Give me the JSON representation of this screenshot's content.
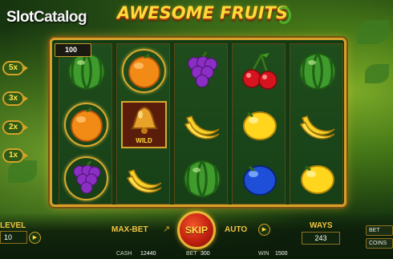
{
  "branding": {
    "site_logo_main": "Slot",
    "site_logo_accent": "Catalog"
  },
  "game": {
    "title": "AWESOME FRUITS"
  },
  "multipliers": [
    "5x",
    "3x",
    "2x",
    "1x"
  ],
  "reels": [
    [
      "watermelon",
      "orange",
      "grapes"
    ],
    [
      "orange",
      "bell-wild",
      "banana"
    ],
    [
      "grapes",
      "banana",
      "watermelon"
    ],
    [
      "cherry",
      "lemon",
      "plum"
    ],
    [
      "watermelon",
      "banana",
      "lemon"
    ]
  ],
  "highlighted_wins": [
    "reel-1-row-2",
    "reel-1-row-3",
    "reel-2-row-1",
    "reel-2-row-2"
  ],
  "symbols": {
    "wild_label": "WILD"
  },
  "win_badge": "100",
  "controls": {
    "level_label": "LEVEL",
    "level_value": "10",
    "max_bet_label": "MAX-BET",
    "spin_label": "SKIP",
    "auto_label": "AUTO",
    "ways_label": "WAYS",
    "ways_value": "243",
    "bet_button": "BET",
    "coins_button": "COINS"
  },
  "footer": {
    "cash_label": "CASH",
    "cash_value": "12440",
    "bet_label": "BET",
    "bet_value": "300",
    "win_label": "WIN",
    "win_value": "1500"
  },
  "colors": {
    "gold": "#d4a22a",
    "title_yellow": "#ffd83a",
    "spin_red": "#c72412",
    "board_green": "#123a14"
  }
}
